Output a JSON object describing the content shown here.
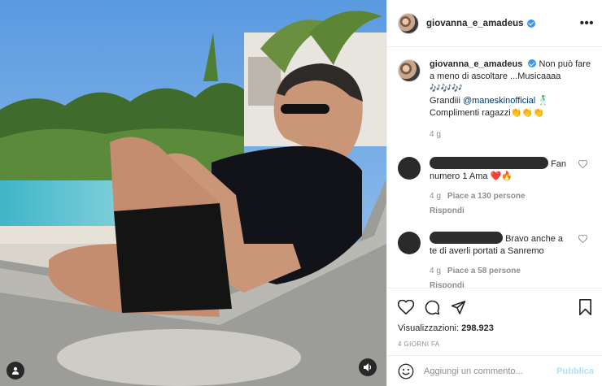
{
  "post": {
    "username": "giovanna_e_amadeus",
    "more_label": "•••"
  },
  "caption": {
    "username": "giovanna_e_amadeus",
    "text_line1": "Non può fare a meno di ascoltare ...Musicaaaa 🎶🎶🎶",
    "text_line2_prefix": "Grandiii ",
    "mention": "@maneskinofficial",
    "text_line2_suffix": " 🕺",
    "text_line3": "Complimenti ragazzi👏👏👏",
    "age": "4 g"
  },
  "comments": [
    {
      "text_a": "Fan",
      "text_b": "numero 1 Ama ❤️🔥",
      "age": "4 g",
      "likes": "Piace a 130 persone",
      "reply_label": "Rispondi"
    },
    {
      "text_a": "Bravo anche a",
      "text_b": "te di averli portati a Sanremo",
      "age": "4 g",
      "likes": "Piace a 58 persone",
      "reply_label": "Rispondi"
    }
  ],
  "stats": {
    "views_label": "Visualizzazioni:",
    "views_count": "298.923",
    "date_label": "4 GIORNI FA"
  },
  "composer": {
    "placeholder": "Aggiungi un commento...",
    "post_label": "Pubblica"
  },
  "colors": {
    "verified": "#3897f0",
    "post_button_disabled": "#b2dffc",
    "heart_red": "#e0245e"
  },
  "icons": [
    "verified-badge-icon",
    "more-options-icon",
    "like-heart-icon",
    "comment-icon",
    "share-icon",
    "save-bookmark-icon",
    "emoji-icon",
    "audio-icon",
    "user-tag-icon"
  ]
}
